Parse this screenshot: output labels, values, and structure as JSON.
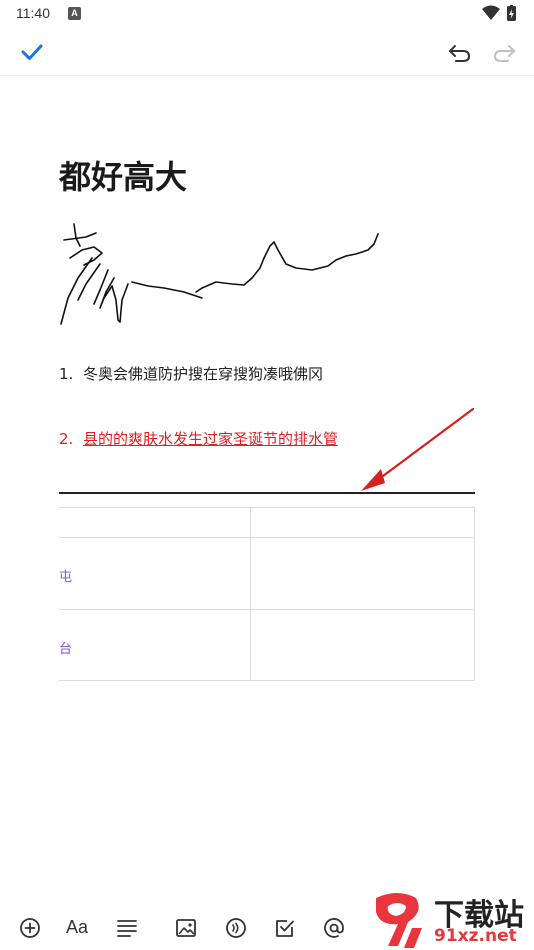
{
  "status_bar": {
    "time": "11:40",
    "indicator": "A"
  },
  "toolbar": {
    "confirm_icon": "check-icon",
    "undo_icon": "undo-icon",
    "redo_icon": "redo-icon",
    "accent": "#1a73e8"
  },
  "document": {
    "title": "都好高大",
    "list": [
      {
        "number": "1.",
        "text": "冬奥会佛道防护搜在穿搜狗凑哦佛冈",
        "color": "#222222"
      },
      {
        "number": "2.",
        "text": "县的的爽肤水发生过家圣诞节的排水管",
        "color": "#e02020"
      }
    ],
    "table": {
      "rows": [
        {
          "cells": [
            "",
            ""
          ]
        },
        {
          "cells": [
            "屯",
            ""
          ]
        },
        {
          "cells": [
            "台",
            ""
          ]
        }
      ]
    }
  },
  "annotation": {
    "arrow_color": "#d42020"
  },
  "bottom_toolbar": {
    "icons": [
      "add-icon",
      "text-format-icon",
      "align-icon",
      "image-icon",
      "audio-icon",
      "checkbox-icon",
      "mention-icon"
    ],
    "font_label": "Aa"
  },
  "watermark": {
    "big_text": "下载站",
    "small_text": "91xz.net"
  }
}
